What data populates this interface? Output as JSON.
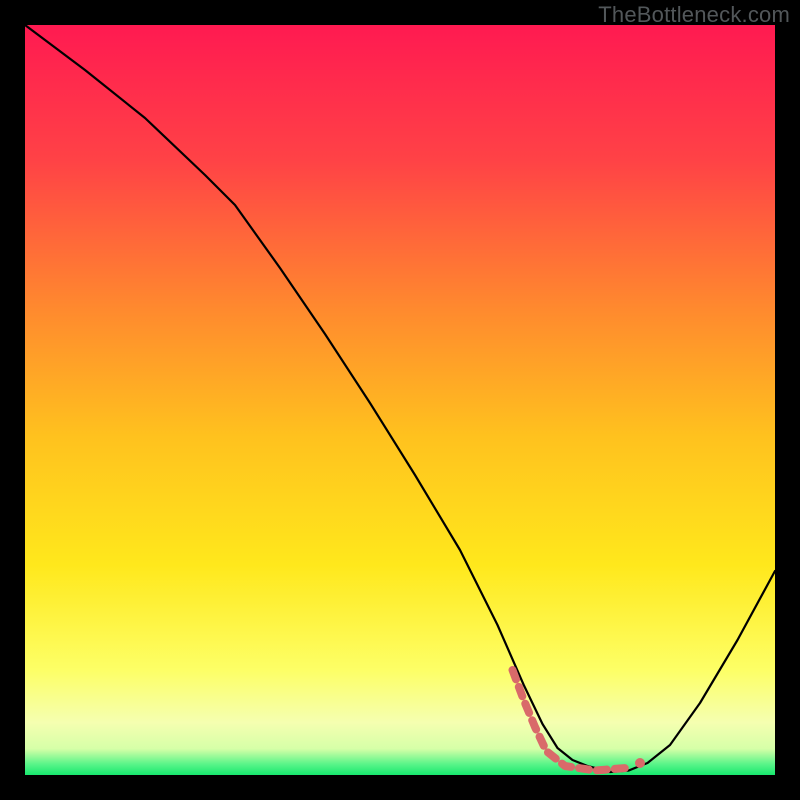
{
  "watermark": "TheBottleneck.com",
  "chart_data": {
    "type": "line",
    "title": "",
    "xlabel": "",
    "ylabel": "",
    "xlim": [
      0,
      100
    ],
    "ylim": [
      0,
      100
    ],
    "gradient_stops": [
      {
        "offset": 0.0,
        "color": "#ff1a51"
      },
      {
        "offset": 0.18,
        "color": "#ff4246"
      },
      {
        "offset": 0.38,
        "color": "#ff8a2e"
      },
      {
        "offset": 0.55,
        "color": "#ffc21e"
      },
      {
        "offset": 0.72,
        "color": "#ffe81c"
      },
      {
        "offset": 0.86,
        "color": "#fdff66"
      },
      {
        "offset": 0.93,
        "color": "#f5ffb0"
      },
      {
        "offset": 0.965,
        "color": "#d6ffa8"
      },
      {
        "offset": 0.985,
        "color": "#5cf58a"
      },
      {
        "offset": 1.0,
        "color": "#17e86e"
      }
    ],
    "series": [
      {
        "name": "main-curve",
        "color": "#000000",
        "width": 2.2,
        "x": [
          0.0,
          8.0,
          16.0,
          24.0,
          28.0,
          34.0,
          40.0,
          46.0,
          52.0,
          58.0,
          63.0,
          66.5,
          69.0,
          71.0,
          73.0,
          75.0,
          78.0,
          80.5,
          83.0,
          86.0,
          90.0,
          95.0,
          100.0
        ],
        "y": [
          100.0,
          94.0,
          87.6,
          80.0,
          76.0,
          67.6,
          58.8,
          49.6,
          40.0,
          30.0,
          20.0,
          12.0,
          6.8,
          3.6,
          2.0,
          1.2,
          0.4,
          0.6,
          1.6,
          4.0,
          9.6,
          18.0,
          27.2
        ]
      },
      {
        "name": "dashed-marker",
        "color": "#d96a6a",
        "width": 8,
        "dash": "10 8",
        "x": [
          65.0,
          66.5,
          68.0,
          69.5,
          72.0,
          76.0,
          81.0
        ],
        "y": [
          14.0,
          10.0,
          6.4,
          3.2,
          1.2,
          0.6,
          1.0
        ]
      }
    ],
    "markers": [
      {
        "x": 82.0,
        "y": 1.6,
        "r": 5,
        "color": "#d96a6a"
      }
    ]
  }
}
